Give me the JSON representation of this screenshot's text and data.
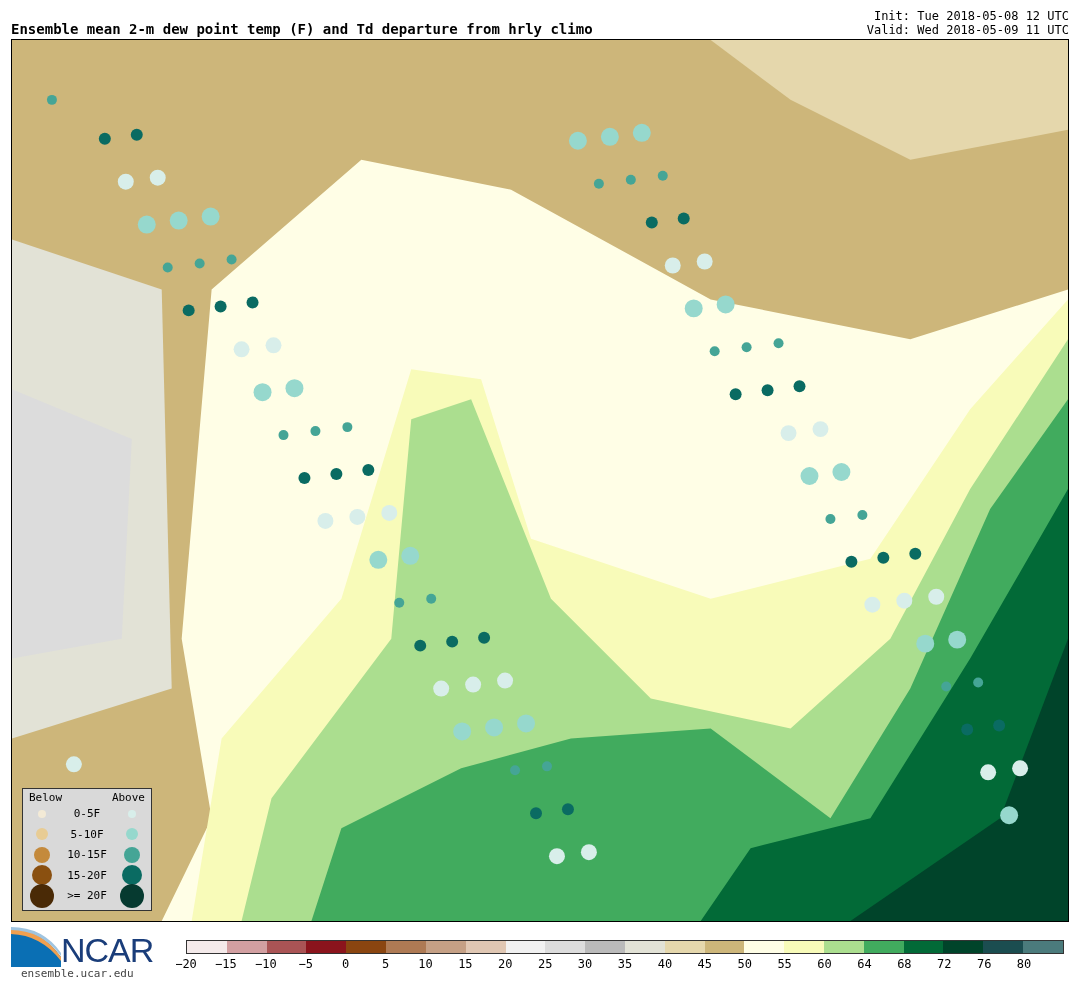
{
  "title": "Ensemble mean 2-m dew point temp (F) and Td departure from hrly climo",
  "init": "Init: Tue 2018-05-08 12 UTC",
  "valid": "Valid: Wed 2018-05-09 11 UTC",
  "legend": {
    "below_heading": "Below",
    "above_heading": "Above",
    "rows": [
      {
        "label": "0-5F",
        "below": {
          "color": "#f3ead6"
        },
        "above": {
          "color": "#d8eeea"
        }
      },
      {
        "label": "5-10F",
        "below": {
          "color": "#e8cc94"
        },
        "above": {
          "color": "#96d8cd"
        }
      },
      {
        "label": "10-15F",
        "below": {
          "color": "#c48a3c"
        },
        "above": {
          "color": "#45a596"
        }
      },
      {
        "label": "15-20F",
        "below": {
          "color": "#8a5010"
        },
        "above": {
          "color": "#0a6b62"
        }
      },
      {
        "label": ">= 20F",
        "below": {
          "color": "#4a2a06"
        },
        "above": {
          "color": "#063a30"
        }
      }
    ]
  },
  "logo": {
    "text": "NCAR",
    "url": "ensemble.ucar.edu"
  },
  "colorbar": {
    "segments": [
      {
        "color": "#f4eaea"
      },
      {
        "color": "#d29fa1"
      },
      {
        "color": "#aa5455"
      },
      {
        "color": "#8b141c"
      },
      {
        "color": "#8a4510"
      },
      {
        "color": "#ae7a54"
      },
      {
        "color": "#c5a085"
      },
      {
        "color": "#e0c7b3"
      },
      {
        "color": "#f1f1f1"
      },
      {
        "color": "#dcdcdc"
      },
      {
        "color": "#bababa"
      },
      {
        "color": "#e2e2d6"
      },
      {
        "color": "#e5d7ac"
      },
      {
        "color": "#cdb67a"
      },
      {
        "color": "#fffee6"
      },
      {
        "color": "#f8fbb9"
      },
      {
        "color": "#abde8f"
      },
      {
        "color": "#41ab5e"
      },
      {
        "color": "#026a37"
      },
      {
        "color": "#00442a"
      },
      {
        "color": "#1b4d50"
      },
      {
        "color": "#4b7b7c"
      }
    ],
    "ticks": [
      "−20",
      "−15",
      "−10",
      "−5",
      "0",
      "5",
      "10",
      "15",
      "20",
      "25",
      "30",
      "35",
      "40",
      "45",
      "50",
      "55",
      "60",
      "64",
      "68",
      "72",
      "76",
      "80"
    ]
  }
}
